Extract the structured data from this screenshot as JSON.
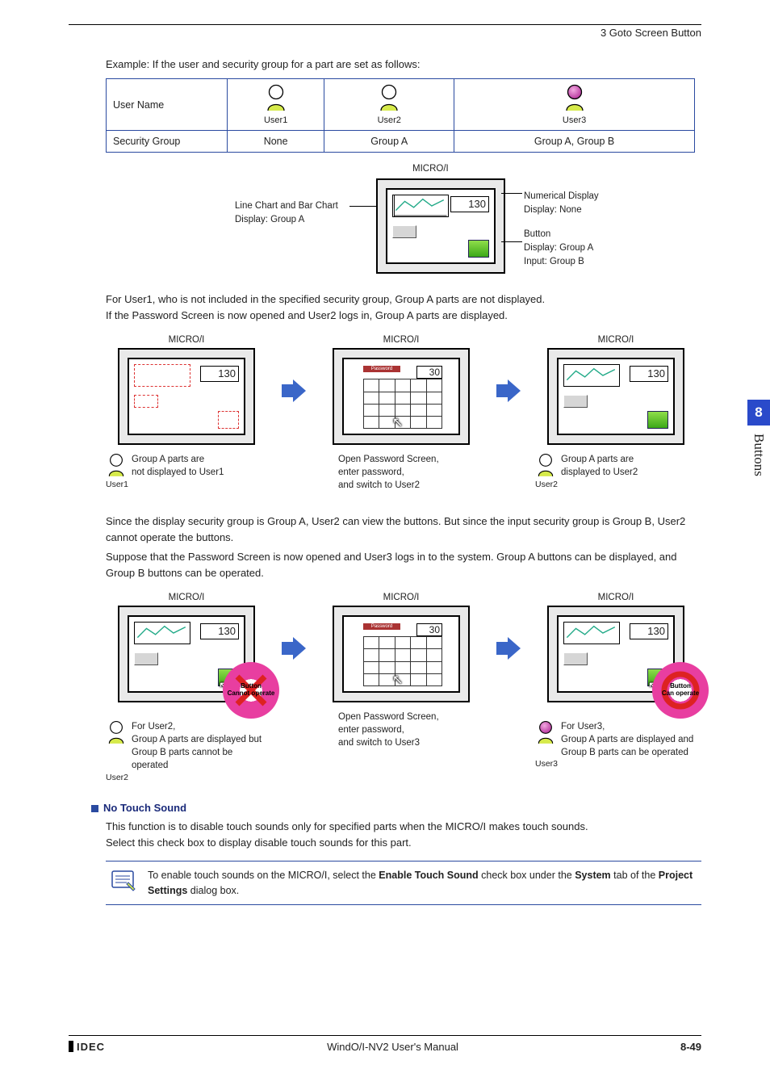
{
  "header": {
    "right": "3 Goto Screen Button"
  },
  "lead": "Example: If the user and security group for a part are set as follows:",
  "table": {
    "row1": {
      "h": "User Name",
      "u1": "User1",
      "u2": "User2",
      "u3": "User3"
    },
    "row2": {
      "h": "Security Group",
      "u1": "None",
      "u2": "Group A",
      "u3": "Group A, Group B"
    }
  },
  "diag1": {
    "title": "MICRO/I",
    "left_l1": "Line Chart and Bar Chart",
    "left_l2": "Display: Group A",
    "right_numdisp": "Numerical Display",
    "right_numdisp2": "Display: None",
    "right_btn": "Button",
    "right_btn2": "Display: Group A",
    "right_btn3": "Input: Group B",
    "value": "130"
  },
  "p1_l1": "For User1, who is not included in the specified security group, Group A parts are not displayed.",
  "p1_l2": "If the Password Screen is now opened and User2 logs in, Group A parts are displayed.",
  "row1": {
    "micro": "MICRO/I",
    "val": "130",
    "pwval": "30",
    "pwlabel": "Password",
    "c1_cap_a": "Group A parts are",
    "c1_cap_b": "not displayed to User1",
    "c1_user": "User1",
    "c2_cap_a": "Open Password Screen,",
    "c2_cap_b": "enter password,",
    "c2_cap_c": "and switch to User2",
    "c3_cap_a": "Group A parts are",
    "c3_cap_b": "displayed to User2",
    "c3_user": "User2"
  },
  "p2": "Since the display security group is Group A, User2 can view the buttons. But since the input security group is Group B, User2 cannot operate the buttons.",
  "p3": "Suppose that the Password Screen is now opened and User3 logs in to the system. Group A buttons can be displayed, and Group B buttons can be operated.",
  "row2": {
    "micro": "MICRO/I",
    "val": "130",
    "pwval": "30",
    "pwlabel": "Password",
    "c1_cap_a": "For User2,",
    "c1_cap_b": "Group A parts are displayed but",
    "c1_cap_c": "Group B parts cannot be operated",
    "c1_user": "User2",
    "c1_badge_a": "Button",
    "c1_badge_b": "Cannot operate",
    "c2_cap_a": "Open Password Screen,",
    "c2_cap_b": "enter password,",
    "c2_cap_c": "and switch to User3",
    "c3_cap_a": "For User3,",
    "c3_cap_b": "Group A parts are displayed and",
    "c3_cap_c": "Group B parts can be operated",
    "c3_user": "User3",
    "c3_badge_a": "Button",
    "c3_badge_b": "Can operate"
  },
  "nts": {
    "title": "No Touch Sound",
    "l1": "This function is to disable touch sounds only for specified parts when the MICRO/I makes touch sounds.",
    "l2": "Select this check box to display disable touch sounds for this part.",
    "note_a": "To enable touch sounds on the MICRO/I, select the ",
    "note_b": "Enable Touch Sound",
    "note_c": " check box under the ",
    "note_d": "System",
    "note_e": " tab of the ",
    "note_f": "Project Settings",
    "note_g": " dialog box."
  },
  "side": {
    "num": "8",
    "label": "Buttons"
  },
  "footer": {
    "brand": "IDEC",
    "title": "WindO/I-NV2 User's Manual",
    "page": "8-49"
  }
}
